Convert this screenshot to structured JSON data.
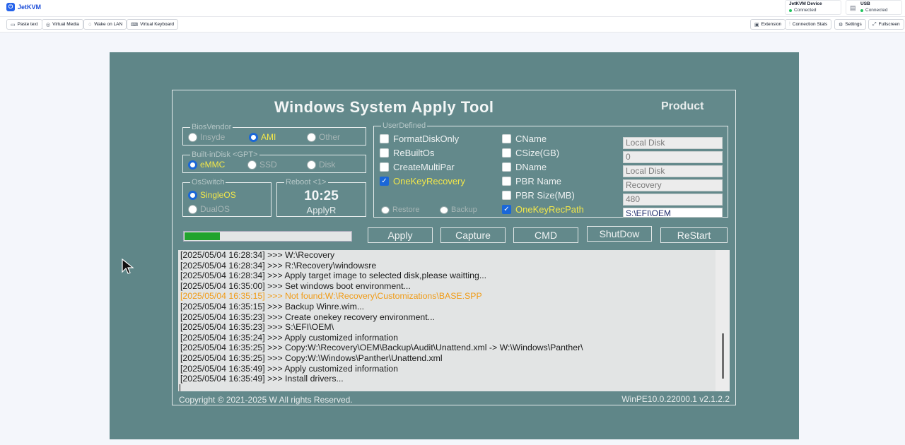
{
  "header": {
    "brand": "JetKVM",
    "device_card": {
      "title": "JetKVM Device",
      "status": "Connected"
    },
    "usb_card": {
      "title": "USB",
      "status": "Connected"
    }
  },
  "toolbar": {
    "left": [
      "Paste text",
      "Virtual Media",
      "Wake on LAN",
      "Virtual Keyboard"
    ],
    "right": [
      "Extension",
      "Connection Stats",
      "Settings",
      "Fullscreen"
    ]
  },
  "app": {
    "title": "Windows System Apply Tool",
    "product": "Product",
    "bios_vendor": {
      "label": "BiosVendor",
      "options": [
        "Insyde",
        "AMI",
        "Other"
      ],
      "selected": "AMI"
    },
    "builtin_disk": {
      "label": "Built-inDisk <GPT>",
      "options": [
        "eMMC",
        "SSD",
        "Disk"
      ],
      "selected": "eMMC"
    },
    "os_switch": {
      "label": "OsSwitch",
      "options": [
        "SingleOS",
        "DualOS"
      ],
      "selected": "SingleOS"
    },
    "reboot": {
      "label": "Reboot <1>",
      "time": "10:25",
      "caption": "ApplyR"
    },
    "user_defined": {
      "label": "UserDefined",
      "col1": [
        {
          "label": "FormatDiskOnly",
          "checked": false
        },
        {
          "label": "ReBuiltOs",
          "checked": false
        },
        {
          "label": "CreateMultiPar",
          "checked": false
        },
        {
          "label": "OneKeyRecovery",
          "checked": true
        }
      ],
      "col2": [
        {
          "label": "CName",
          "checked": false
        },
        {
          "label": "CSize(GB)",
          "checked": false
        },
        {
          "label": "DName",
          "checked": false
        },
        {
          "label": "PBR Name",
          "checked": false
        },
        {
          "label": "PBR Size(MB)",
          "checked": false
        },
        {
          "label": "OneKeyRecPath",
          "checked": true
        }
      ],
      "restore": "Restore",
      "backup": "Backup",
      "fields": [
        "Local Disk",
        "0",
        "Local Disk",
        "Recovery",
        "480",
        "S:\\EFI\\OEM"
      ]
    },
    "progress_fraction": 0.21,
    "buttons": [
      "Apply",
      "Capture",
      "CMD",
      "ShutDow",
      "ReStart"
    ],
    "log": [
      {
        "text": "[2025/05/04 16:28:34] >>> W:\\Recovery",
        "level": "info"
      },
      {
        "text": "[2025/05/04 16:28:34] >>> R:\\Recovery\\windowsre",
        "level": "info"
      },
      {
        "text": "[2025/05/04 16:28:34] >>> Apply target image to selected disk,please waitting...",
        "level": "info"
      },
      {
        "text": "[2025/05/04 16:35:00] >>> Set windows boot environment...",
        "level": "info"
      },
      {
        "text": "[2025/05/04 16:35:15] >>> Not found:W:\\Recovery\\Customizations\\BASE.SPP",
        "level": "warn"
      },
      {
        "text": "[2025/05/04 16:35:15] >>> Backup Winre.wim...",
        "level": "info"
      },
      {
        "text": "[2025/05/04 16:35:23] >>> Create onekey recovery environment...",
        "level": "info"
      },
      {
        "text": "[2025/05/04 16:35:23] >>> S:\\EFI\\OEM\\",
        "level": "info"
      },
      {
        "text": "[2025/05/04 16:35:24] >>> Apply customized information",
        "level": "info"
      },
      {
        "text": "[2025/05/04 16:35:25] >>> Copy:W:\\Recovery\\OEM\\Backup\\Audit\\Unattend.xml -> W:\\Windows\\Panther\\",
        "level": "info"
      },
      {
        "text": "[2025/05/04 16:35:25] >>> Copy:W:\\Windows\\Panther\\Unattend.xml",
        "level": "info"
      },
      {
        "text": "[2025/05/04 16:35:49] >>> Apply customized information",
        "level": "info"
      },
      {
        "text": "[2025/05/04 16:35:49] >>> Install drivers...",
        "level": "info"
      }
    ],
    "footer_left": "Copyright © 2021-2025 W All rights Reserved.",
    "footer_right": "WinPE10.0.22000.1  v2.1.2.2"
  }
}
